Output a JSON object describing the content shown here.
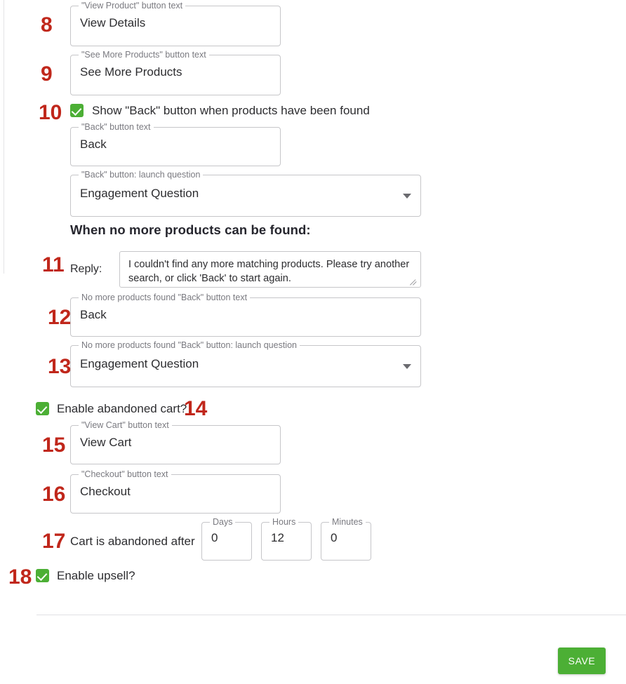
{
  "panel": {
    "section_heading": "When no more products can be found:"
  },
  "fields": {
    "view_product": {
      "label": "\"View Product\" button text",
      "value": "View Details"
    },
    "see_more_products": {
      "label": "\"See More Products\" button text",
      "value": "See More Products"
    },
    "back_button_text": {
      "label": "\"Back\" button text",
      "value": "Back"
    },
    "back_launch_question": {
      "label": "\"Back\" button: launch question",
      "value": "Engagement Question"
    },
    "no_more_back_text": {
      "label": "No more products found \"Back\" button text",
      "value": "Back"
    },
    "no_more_back_launch": {
      "label": "No more products found \"Back\" button: launch question",
      "value": "Engagement Question"
    },
    "view_cart": {
      "label": "\"View Cart\" button text",
      "value": "View Cart"
    },
    "checkout": {
      "label": "\"Checkout\" button text",
      "value": "Checkout"
    },
    "days": {
      "label": "Days",
      "value": "0"
    },
    "hours": {
      "label": "Hours",
      "value": "12"
    },
    "minutes": {
      "label": "Minutes",
      "value": "0"
    }
  },
  "reply": {
    "label": "Reply:",
    "value": "I couldn't find any more matching products.  Please try another search, or click 'Back' to start again."
  },
  "checkboxes": {
    "show_back": {
      "label": "Show \"Back\" button when products have been found",
      "checked": true
    },
    "abandoned_cart": {
      "label": "Enable abandoned cart?",
      "checked": true
    },
    "upsell": {
      "label": "Enable upsell?",
      "checked": true
    }
  },
  "labels": {
    "cart_abandoned_after": "Cart is abandoned after"
  },
  "annotations": {
    "n8": "8",
    "n9": "9",
    "n10": "10",
    "n11": "11",
    "n12": "12",
    "n13": "13",
    "n14": "14",
    "n15": "15",
    "n16": "16",
    "n17": "17",
    "n18": "18"
  },
  "footer": {
    "save_label": "SAVE"
  },
  "colors": {
    "accent_green": "#4caf35",
    "annotation_red": "#c0271b",
    "field_border": "#c6c6c9",
    "label_gray": "#7a7a80"
  }
}
